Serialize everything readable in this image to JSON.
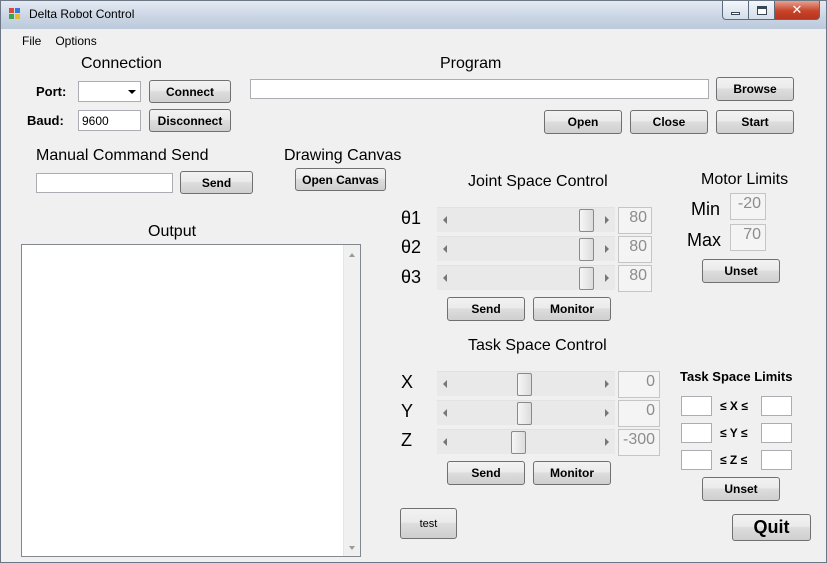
{
  "window": {
    "title": "Delta Robot Control",
    "icons": {
      "app": "app-icon",
      "minimize": "minimize-icon",
      "maximize": "maximize-icon",
      "close": "close-icon"
    }
  },
  "menu": {
    "items": [
      "File",
      "Options"
    ]
  },
  "connection": {
    "title": "Connection",
    "port_label": "Port:",
    "port_value": "",
    "baud_label": "Baud:",
    "baud_value": "9600",
    "connect_label": "Connect",
    "disconnect_label": "Disconnect"
  },
  "program": {
    "title": "Program",
    "path_value": "",
    "browse_label": "Browse",
    "open_label": "Open",
    "close_label": "Close",
    "start_label": "Start"
  },
  "manual": {
    "title": "Manual Command Send",
    "command_value": "",
    "send_label": "Send"
  },
  "drawing": {
    "title": "Drawing Canvas",
    "open_label": "Open Canvas"
  },
  "output": {
    "title": "Output",
    "text": ""
  },
  "joint": {
    "title": "Joint Space Control",
    "rows": [
      {
        "label": "θ1",
        "value": "80"
      },
      {
        "label": "θ2",
        "value": "80"
      },
      {
        "label": "θ3",
        "value": "80"
      }
    ],
    "send_label": "Send",
    "monitor_label": "Monitor"
  },
  "motor_limits": {
    "title": "Motor Limits",
    "min_label": "Min",
    "min_value": "-20",
    "max_label": "Max",
    "max_value": "70",
    "unset_label": "Unset"
  },
  "task": {
    "title": "Task Space Control",
    "rows": [
      {
        "label": "X",
        "value": "0"
      },
      {
        "label": "Y",
        "value": "0"
      },
      {
        "label": "Z",
        "value": "-300"
      }
    ],
    "send_label": "Send",
    "monitor_label": "Monitor"
  },
  "task_limits": {
    "title": "Task Space Limits",
    "rows": [
      {
        "label": "≤ X ≤",
        "low": "",
        "high": ""
      },
      {
        "label": "≤ Y ≤",
        "low": "",
        "high": ""
      },
      {
        "label": "≤ Z ≤",
        "low": "",
        "high": ""
      }
    ],
    "unset_label": "Unset"
  },
  "test_label": "test",
  "quit_label": "Quit"
}
